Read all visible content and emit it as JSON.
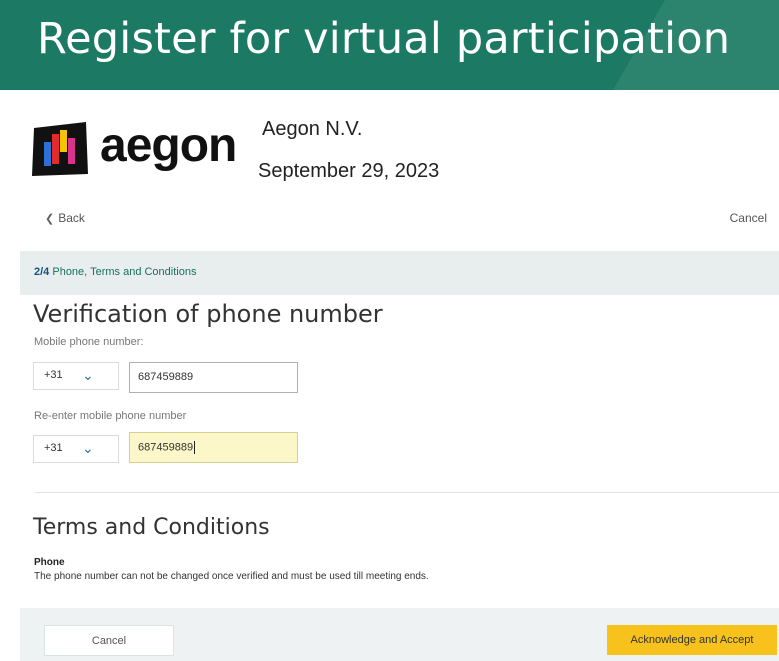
{
  "banner": {
    "title": "Register for virtual participation"
  },
  "company": {
    "logo_text": "aegon",
    "name": "Aegon N.V.",
    "date": "September 29, 2023"
  },
  "nav": {
    "back_label": "Back",
    "cancel_label": "Cancel"
  },
  "step": {
    "number": "2/4",
    "label": "Phone, Terms and Conditions"
  },
  "verification": {
    "heading": "Verification of phone number",
    "mobile_label": "Mobile phone number:",
    "reenter_label": "Re-enter mobile phone number",
    "country_code_1": "+31",
    "country_code_2": "+31",
    "phone_value_1": "687459889",
    "phone_value_2": "687459889"
  },
  "terms": {
    "heading": "Terms and Conditions",
    "phone_heading": "Phone",
    "phone_text": "The phone number can not be changed once verified and must be used till meeting ends."
  },
  "footer": {
    "cancel_label": "Cancel",
    "accept_label": "Acknowledge and Accept"
  },
  "colors": {
    "banner": "#1c7a64",
    "accept": "#f6c21b",
    "step_bar": "#e8eeee"
  }
}
